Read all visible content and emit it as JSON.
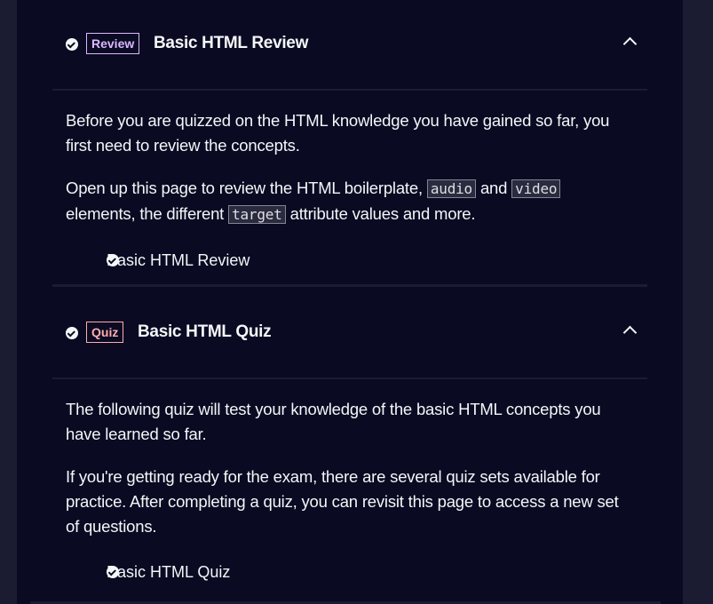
{
  "sections": [
    {
      "badge": "Review",
      "badge_color": "#dbb8ff",
      "title": "Basic HTML Review",
      "completed": true,
      "expanded": true,
      "paragraph1": "Before you are quizzed on the HTML knowledge you have gained so far, you first need to review the concepts.",
      "p2_a": "Open up this page to review the HTML boilerplate, ",
      "code1": "audio",
      "p2_b": " and ",
      "code2": "video",
      "p2_c": " elements, the different ",
      "code3": "target",
      "p2_d": " attribute values and more.",
      "link": "Basic HTML Review"
    },
    {
      "badge": "Quiz",
      "badge_color": "#ffadad",
      "title": "Basic HTML Quiz",
      "completed": true,
      "expanded": true,
      "paragraph1": "The following quiz will test your knowledge of the basic HTML concepts you have learned so far.",
      "paragraph2": "If you're getting ready for the exam, there are several quiz sets available for practice. After completing a quiz, you can revisit this page to access a new set of questions.",
      "link": "Basic HTML Quiz"
    }
  ]
}
